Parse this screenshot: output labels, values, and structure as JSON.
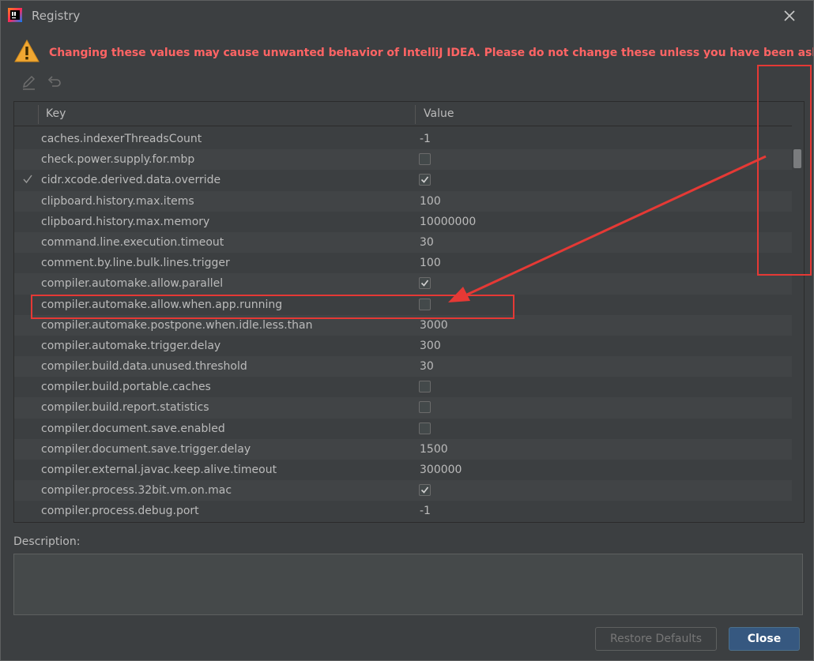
{
  "window": {
    "title": "Registry",
    "app_icon": "intellij-idea-icon"
  },
  "warning": {
    "icon": "warning-triangle-icon",
    "text": "Changing these values may cause unwanted behavior of IntelliJ IDEA. Please do not change these unless you have been asked."
  },
  "toolbar": {
    "edit_icon": "pencil-icon",
    "revert_icon": "undo-icon"
  },
  "table": {
    "headers": {
      "key": "Key",
      "value": "Value"
    },
    "rows": [
      {
        "key": "caches.indexerThreadsCount",
        "value": "-1"
      },
      {
        "key": "check.power.supply.for.mbp",
        "checkbox": false
      },
      {
        "key": "cidr.xcode.derived.data.override",
        "checkbox": true,
        "modified": true
      },
      {
        "key": "clipboard.history.max.items",
        "value": "100"
      },
      {
        "key": "clipboard.history.max.memory",
        "value": "10000000"
      },
      {
        "key": "command.line.execution.timeout",
        "value": "30"
      },
      {
        "key": "comment.by.line.bulk.lines.trigger",
        "value": "100"
      },
      {
        "key": "compiler.automake.allow.parallel",
        "checkbox": true
      },
      {
        "key": "compiler.automake.allow.when.app.running",
        "checkbox": false,
        "highlighted": true
      },
      {
        "key": "compiler.automake.postpone.when.idle.less.than",
        "value": "3000"
      },
      {
        "key": "compiler.automake.trigger.delay",
        "value": "300"
      },
      {
        "key": "compiler.build.data.unused.threshold",
        "value": "30"
      },
      {
        "key": "compiler.build.portable.caches",
        "checkbox": false
      },
      {
        "key": "compiler.build.report.statistics",
        "checkbox": false
      },
      {
        "key": "compiler.document.save.enabled",
        "checkbox": false
      },
      {
        "key": "compiler.document.save.trigger.delay",
        "value": "1500"
      },
      {
        "key": "compiler.external.javac.keep.alive.timeout",
        "value": "300000"
      },
      {
        "key": "compiler.process.32bit.vm.on.mac",
        "checkbox": true
      },
      {
        "key": "compiler.process.debug.port",
        "value": "-1"
      }
    ]
  },
  "description": {
    "label": "Description:",
    "value": ""
  },
  "buttons": {
    "restore": "Restore Defaults",
    "close": "Close"
  },
  "colors": {
    "warning": "#ff6464",
    "annotation": "#e53935",
    "primary_button": "#365880"
  }
}
